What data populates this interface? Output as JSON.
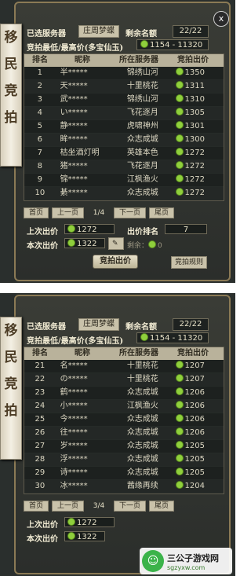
{
  "panel1": {
    "scroll_title": [
      "移",
      "民",
      "竞",
      "拍"
    ],
    "close": "x",
    "selected_server_label": "已选服务器",
    "selected_server_value": "庄周梦蝶",
    "remaining_label": "剩余名额",
    "remaining_value": "22/22",
    "price_label": "竞拍最低/最高价(多宝仙玉)",
    "price_value": "1154 - 11320",
    "columns": [
      "排名",
      "昵称",
      "所在服务器",
      "竞拍出价"
    ],
    "rows": [
      [
        "1",
        "半*****",
        "锦绣山河",
        "1350"
      ],
      [
        "2",
        "天*****",
        "十里桃花",
        "1311"
      ],
      [
        "3",
        "武*****",
        "锦绣山河",
        "1310"
      ],
      [
        "4",
        "い*****",
        "飞花逐月",
        "1305"
      ],
      [
        "5",
        "静*****",
        "虎啸神州",
        "1301"
      ],
      [
        "6",
        "眸*****",
        "众志成城",
        "1300"
      ],
      [
        "7",
        "枯坐酒灯明",
        "英雄本色",
        "1272"
      ],
      [
        "8",
        "猪*****",
        "飞花逐月",
        "1272"
      ],
      [
        "9",
        "锦*****",
        "江枫渔火",
        "1272"
      ],
      [
        "10",
        "綦*****",
        "众志成城",
        "1272"
      ]
    ],
    "first_page": "首页",
    "prev_page": "上一页",
    "page_indicator": "1/4",
    "next_page": "下一页",
    "last_page": "尾页",
    "last_bid_label": "上次出价",
    "last_bid_value": "1272",
    "bid_rank_label": "出价排名",
    "bid_rank_value": "7",
    "this_bid_label": "本次出价",
    "this_bid_value": "1322",
    "remaining_small_label": "剩余：",
    "remaining_small_value": "0",
    "bid_button": "竞拍出价",
    "rules_button": "竞拍规则"
  },
  "panel2": {
    "scroll_title": [
      "移",
      "民",
      "竞",
      "拍"
    ],
    "selected_server_label": "已选服务器",
    "selected_server_value": "庄周梦蝶",
    "remaining_label": "剩余名额",
    "remaining_value": "22/22",
    "price_label": "竞拍最低/最高价(多宝仙玉)",
    "price_value": "1154 - 11320",
    "columns": [
      "排名",
      "昵称",
      "所在服务器",
      "竞拍出价"
    ],
    "rows": [
      [
        "21",
        "名*****",
        "十里桃花",
        "1207"
      ],
      [
        "22",
        "の*****",
        "十里桃花",
        "1207"
      ],
      [
        "23",
        "鹤*****",
        "众志成城",
        "1206"
      ],
      [
        "24",
        "小*****",
        "江枫渔火",
        "1206"
      ],
      [
        "25",
        "今*****",
        "众志成城",
        "1206"
      ],
      [
        "26",
        "往*****",
        "众志成城",
        "1206"
      ],
      [
        "27",
        "岁*****",
        "众志成城",
        "1205"
      ],
      [
        "28",
        "浮*****",
        "众志成城",
        "1205"
      ],
      [
        "29",
        "诗*****",
        "众志成城",
        "1205"
      ],
      [
        "30",
        "冰*****",
        "茜缘再续",
        "1204"
      ]
    ],
    "first_page": "首页",
    "prev_page": "上一页",
    "page_indicator": "3/4",
    "next_page": "下一页",
    "last_page": "尾页",
    "last_bid_label": "上次出价",
    "last_bid_value": "1272",
    "this_bid_label": "本次出价",
    "this_bid_value": "1322"
  },
  "watermark": {
    "name": "三公子游戏网",
    "url": "sgzyxw.com",
    "logo_glyph": "☺"
  }
}
